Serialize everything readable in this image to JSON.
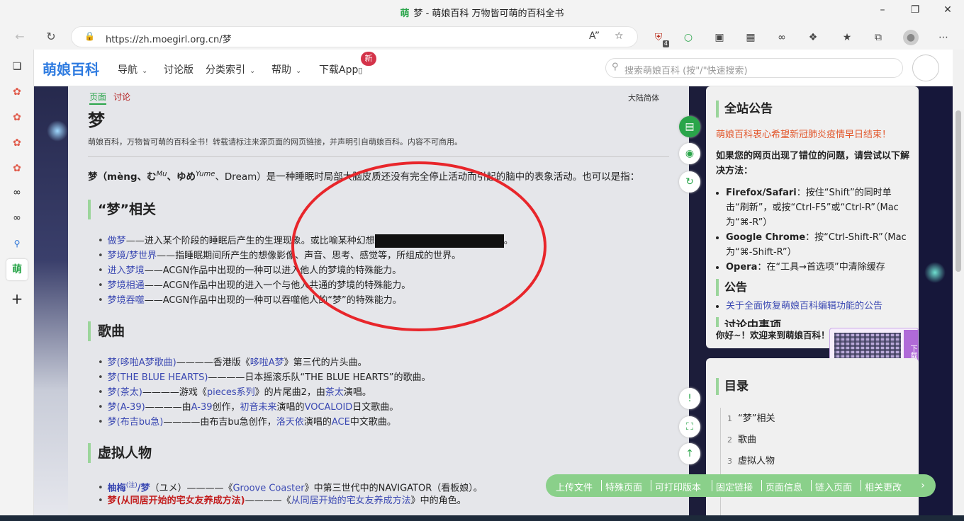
{
  "browser": {
    "window_title": "梦 - 萌娘百科 万物皆可萌的百科全书",
    "tab_logo": "萌",
    "url": "https://zh.moegirl.org.cn/梦",
    "extension_badge": "4"
  },
  "edge_sidebar": {
    "active_logo": "萌"
  },
  "site": {
    "logo": "萌娘百科",
    "nav": [
      "导航",
      "讨论版",
      "分类索引",
      "帮助",
      "下载App"
    ],
    "new_badge": "新",
    "search_placeholder": "搜索萌娘百科 (按\"/\"快速搜索)"
  },
  "content": {
    "tab_page": "页面",
    "tab_talk": "讨论",
    "variant": "大陆简体",
    "title": "梦",
    "subtitle": "萌娘百科，万物皆可萌的百科全书！转载请标注来源页面的网页链接，并声明引自萌娘百科。内容不可商用。",
    "intro_prefix": "梦（mèng、む",
    "intro_sup1": "Mu",
    "intro_mid": "、ゆめ",
    "intro_sup2": "Yume",
    "intro_suffix": "、Dream）是一种睡眠时局部大脑皮质还没有完全停止活动而引起的脑中的表象活动。也可以是指：",
    "sections": [
      {
        "heading": "“梦”相关",
        "items": [
          {
            "link": "做梦",
            "text": "——进入某个阶段的睡眠后产生的生理现象。或比喻某种幻想",
            "tail": "。"
          },
          {
            "link": "梦境/梦世界",
            "text": "——指睡眠期间所产生的想像影像、声音、思考、感觉等，所组成的世界。"
          },
          {
            "link": "进入梦境",
            "text": "——ACGN作品中出现的一种可以进入他人的梦境的特殊能力。"
          },
          {
            "link": "梦境相通",
            "text": "——ACGN作品中出现的进入一个与他人共通的梦境的特殊能力。"
          },
          {
            "link": "梦境吞噬",
            "text": "——ACGN作品中出现的一种可以吞噬他人的“梦”的特殊能力。"
          }
        ]
      },
      {
        "heading": "歌曲",
        "items": [
          {
            "link": "梦(哆啦A梦歌曲)",
            "text": "————香港版《",
            "link2": "哆啦A梦",
            "text2": "》第三代的片头曲。"
          },
          {
            "link": "梦(THE BLUE HEARTS)",
            "text": "————日本摇滚乐队“THE BLUE HEARTS”的歌曲。"
          },
          {
            "link": "梦(茶太)",
            "text": "————游戏《",
            "link2": "pieces系列",
            "text2": "》的片尾曲2，由",
            "link3": "茶太",
            "text3": "演唱。"
          },
          {
            "link": "梦(A-39)",
            "text": "————由",
            "link2": "A-39",
            "text2": "创作，",
            "link3": "初音未来",
            "text3": "演唱的",
            "link4": "VOCALOID",
            "text4": "日文歌曲。"
          },
          {
            "link": "梦(布吉bu急)",
            "text": "————由布吉bu急创作，",
            "link2": "洛天依",
            "text2": "演唱的",
            "link3": "ACE",
            "text3": "中文歌曲。"
          }
        ]
      },
      {
        "heading": "虚拟人物",
        "items": [
          {
            "link": "柚梅",
            "sup": "(注)",
            "link2": "/梦",
            "text": "（ユメ）————《",
            "link3": "Groove Coaster",
            "text2": "》中第三世代中的NAVIGATOR（看板娘）。"
          },
          {
            "link": "梦(从同居开始的宅女友养成方法)",
            "text": "————《",
            "link2": "从同居开始的宅女友养成方法",
            "text2": "》中的角色。"
          }
        ]
      }
    ]
  },
  "notice": {
    "heading": "全站公告",
    "alert": "萌娘百科衷心希望新冠肺炎疫情早日结束！",
    "intro": "如果您的网页出现了错位的问题，请尝试以下解决方法：",
    "tips": [
      {
        "browser": "Firefox/Safari",
        "text": "：按住“Shift”的同时单击“刷新”，或按“Ctrl-F5”或“Ctrl-R”（Mac为“⌘-R”）"
      },
      {
        "browser": "Google Chrome",
        "text": "：按“Ctrl-Shift-R”（Mac为“⌘-Shift-R”）"
      },
      {
        "browser": "Opera",
        "text": "：在“工具→首选项”中清除缓存"
      }
    ],
    "sub_heading": "公告",
    "announce_link": "关于全面恢复萌娘百科编辑功能的公告",
    "talk_heading": "讨论中事项",
    "welcome": "你好~！欢迎来到萌娘百科！",
    "qr_side": "下载萌娘APP"
  },
  "toc": {
    "heading": "目录",
    "items": [
      {
        "num": "1",
        "label": "“梦”相关"
      },
      {
        "num": "2",
        "label": "歌曲"
      },
      {
        "num": "3",
        "label": "虚拟人物"
      }
    ]
  },
  "bottom_bar": [
    "上传文件",
    "特殊页面",
    "可打印版本",
    "固定链接",
    "页面信息",
    "链入页面",
    "相关更改"
  ]
}
